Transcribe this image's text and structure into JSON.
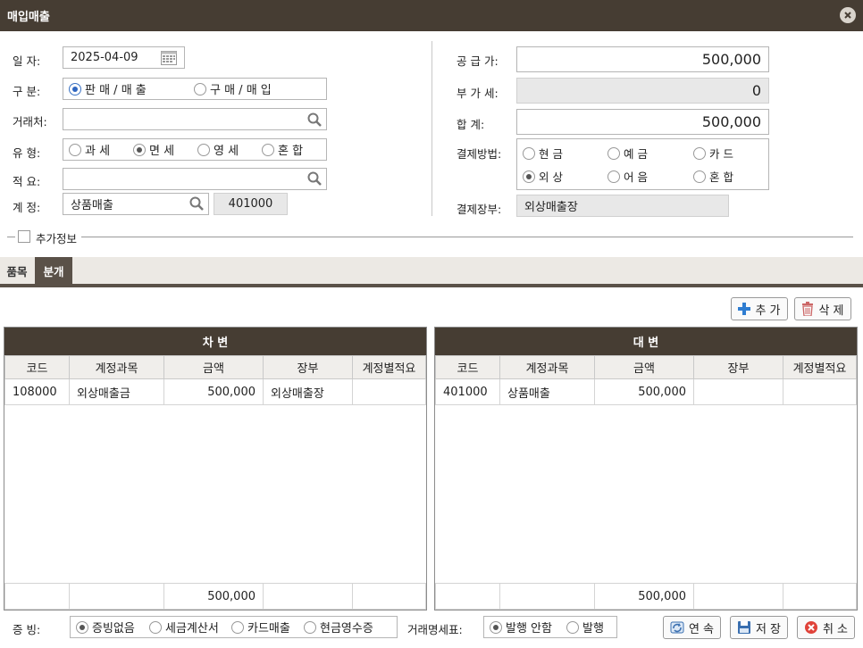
{
  "window": {
    "title": "매입매출"
  },
  "form": {
    "date_label": "일  자:",
    "date_value": "2025-04-09",
    "type_label": "구  분:",
    "type_options": [
      "판 매 / 매 출",
      "구 매 / 매 입"
    ],
    "type_selected": 0,
    "partner_label": "거래처:",
    "partner_value": "",
    "kind_label": "유  형:",
    "kind_options": [
      "과 세",
      "면 세",
      "영 세",
      "혼 합"
    ],
    "kind_selected": 1,
    "memo_label": "적  요:",
    "memo_value": "",
    "account_label": "계  정:",
    "account_value": "상품매출",
    "account_code": "401000",
    "supply_label": "공 급 가:",
    "supply_value": "500,000",
    "vat_label": "부 가 세:",
    "vat_value": "0",
    "total_label": "합    계:",
    "total_value": "500,000",
    "pay_label": "결제방법:",
    "pay_options": [
      "현 금",
      "예 금",
      "카 드",
      "외 상",
      "어 음",
      "혼 합"
    ],
    "pay_selected": 3,
    "ledger_label": "결제장부:",
    "ledger_value": "외상매출장",
    "extra_info_label": "추가정보"
  },
  "tabs": [
    {
      "label": "품목"
    },
    {
      "label": "분개"
    }
  ],
  "toolbar": {
    "add_label": "추 가",
    "delete_label": "삭 제"
  },
  "debit": {
    "title": "차 변",
    "columns": [
      "코드",
      "계정과목",
      "금액",
      "장부",
      "계정별적요"
    ],
    "rows": [
      [
        "108000",
        "외상매출금",
        "500,000",
        "외상매출장",
        ""
      ]
    ],
    "total": "500,000"
  },
  "credit": {
    "title": "대 변",
    "columns": [
      "코드",
      "계정과목",
      "금액",
      "장부",
      "계정별적요"
    ],
    "rows": [
      [
        "401000",
        "상품매출",
        "500,000",
        "",
        ""
      ]
    ],
    "total": "500,000"
  },
  "footer": {
    "evidence_label": "증 빙:",
    "evidence_options": [
      "증빙없음",
      "세금계산서",
      "카드매출",
      "현금영수증"
    ],
    "evidence_selected": 0,
    "statement_label": "거래명세표:",
    "statement_options": [
      "발행 안함",
      "발행"
    ],
    "statement_selected": 0,
    "continue_label": "연 속",
    "save_label": "저 장",
    "cancel_label": "취 소"
  }
}
